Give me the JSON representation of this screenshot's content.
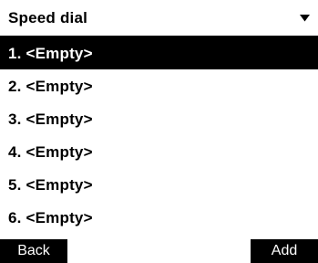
{
  "header": {
    "title": "Speed dial",
    "dropdown_icon": "chevron-down-icon"
  },
  "list": {
    "items": [
      {
        "label": "1. <Empty>",
        "selected": true
      },
      {
        "label": "2. <Empty>",
        "selected": false
      },
      {
        "label": "3. <Empty>",
        "selected": false
      },
      {
        "label": "4. <Empty>",
        "selected": false
      },
      {
        "label": "5. <Empty>",
        "selected": false
      },
      {
        "label": "6. <Empty>",
        "selected": false
      }
    ]
  },
  "softkeys": {
    "left_label": "Back",
    "right_label": "Add"
  },
  "colors": {
    "background": "#ffffff",
    "foreground": "#000000",
    "selected_background": "#000000",
    "selected_text": "#ffffff"
  }
}
